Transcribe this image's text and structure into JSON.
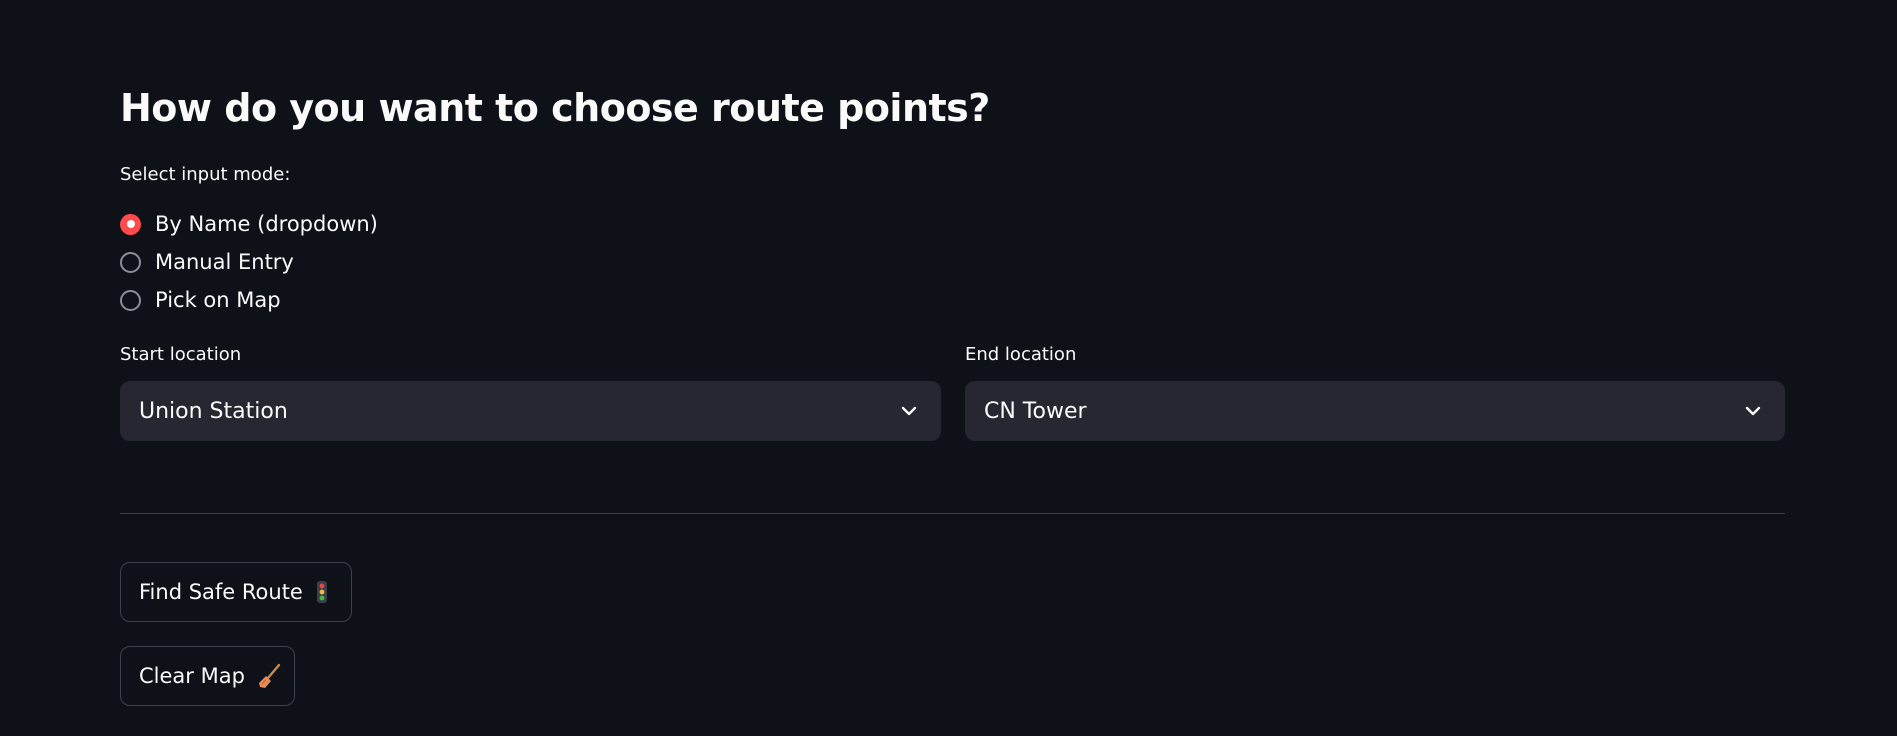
{
  "heading": "How do you want to choose route points?",
  "input_mode": {
    "label": "Select input mode:",
    "options": [
      {
        "label": "By Name (dropdown)",
        "selected": true
      },
      {
        "label": "Manual Entry",
        "selected": false
      },
      {
        "label": "Pick on Map",
        "selected": false
      }
    ]
  },
  "start": {
    "label": "Start location",
    "value": "Union Station",
    "icon": "chevron-down-icon"
  },
  "end": {
    "label": "End location",
    "value": "CN Tower",
    "icon": "chevron-down-icon"
  },
  "buttons": {
    "find_label": "Find Safe Route",
    "find_icon": "traffic-light-icon",
    "clear_label": "Clear Map",
    "clear_icon": "broom-icon"
  },
  "colors": {
    "background": "#0e1117",
    "accent": "#ff4b4b",
    "input_bg": "#262730",
    "text": "#fafafa"
  }
}
